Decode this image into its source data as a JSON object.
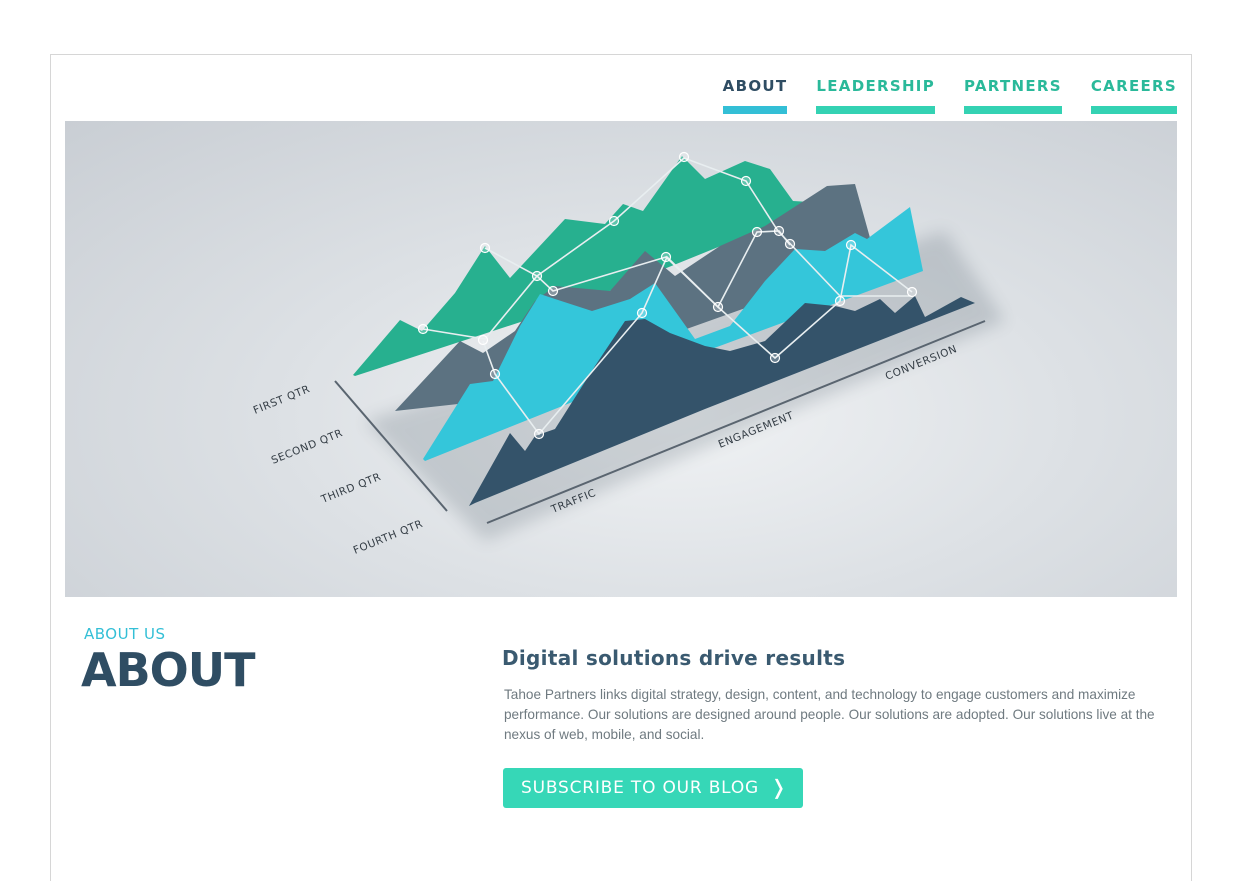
{
  "nav": {
    "items": [
      {
        "label": "ABOUT",
        "active": true
      },
      {
        "label": "LEADERSHIP",
        "active": false
      },
      {
        "label": "PARTNERS",
        "active": false
      },
      {
        "label": "CAREERS",
        "active": false
      }
    ]
  },
  "hero": {
    "row_labels": [
      "FIRST QTR",
      "SECOND QTR",
      "THIRD QTR",
      "FOURTH QTR"
    ],
    "axis_labels": [
      "TRAFFIC",
      "ENGAGEMENT",
      "CONVERSION"
    ],
    "colors": {
      "first": "#27b08f",
      "second": "#5c7281",
      "third": "#34c6da",
      "fourth": "#34536a",
      "nodes": "#ffffff"
    }
  },
  "about": {
    "section_label": "ABOUT US",
    "title": "ABOUT",
    "headline": "Digital solutions drive results",
    "body": "Tahoe Partners links digital strategy, design, content, and technology to engage customers and maximize performance. Our solutions are designed around people. Our solutions are adopted. Our solutions live at the nexus of web, mobile, and social.",
    "cta_label": "SUBSCRIBE TO OUR BLOG",
    "cta_icon": "chevron-right-icon",
    "cta_glyph": "❭"
  }
}
